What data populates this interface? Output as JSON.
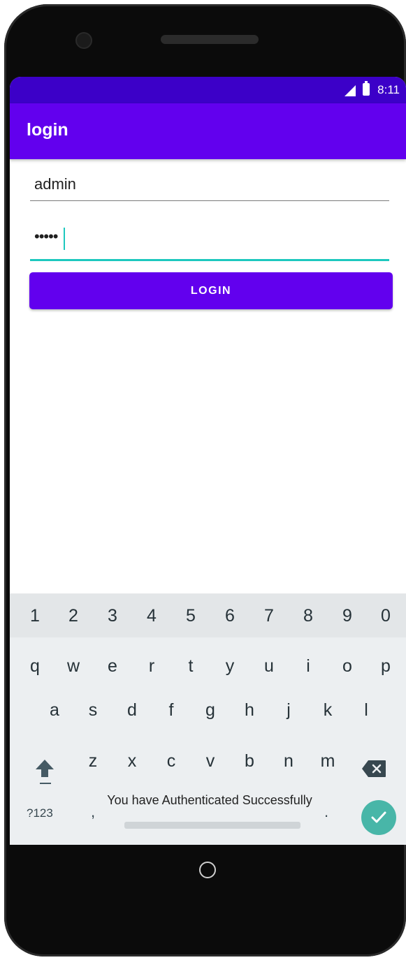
{
  "status_bar": {
    "time": "8:11"
  },
  "app_bar": {
    "title": "login"
  },
  "form": {
    "username_value": "admin",
    "password_value": "•••••",
    "login_button_label": "LOGIN"
  },
  "keyboard": {
    "number_row": [
      "1",
      "2",
      "3",
      "4",
      "5",
      "6",
      "7",
      "8",
      "9",
      "0"
    ],
    "row_q": [
      "q",
      "w",
      "e",
      "r",
      "t",
      "y",
      "u",
      "i",
      "o",
      "p"
    ],
    "row_a": [
      "a",
      "s",
      "d",
      "f",
      "g",
      "h",
      "j",
      "k",
      "l"
    ],
    "row_z": [
      "z",
      "x",
      "c",
      "v",
      "b",
      "n",
      "m"
    ],
    "symbols_label": "?123",
    "comma": ",",
    "period": "."
  },
  "toast": {
    "message": "You have Authenticated Successfully"
  },
  "colors": {
    "status_bar": "#3c00c8",
    "app_bar": "#6200ee",
    "button": "#6200ee",
    "focus_accent": "#1dc8be",
    "enter_key": "#48b6a8"
  },
  "icons": [
    "signal-icon",
    "battery-icon",
    "shift-icon",
    "backspace-icon",
    "checkmark-icon",
    "home-icon"
  ]
}
